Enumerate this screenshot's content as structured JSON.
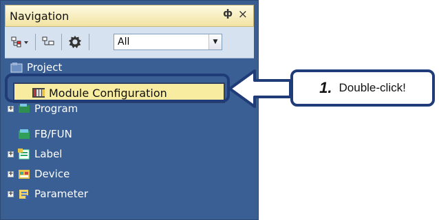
{
  "nav": {
    "title": "Navigation",
    "pin_glyph": "ф",
    "close_glyph": "×",
    "filter_value": "All",
    "tree": [
      {
        "label": "Project",
        "icon": "project-icon"
      },
      {
        "label": "Module Configuration",
        "icon": "module-configuration-icon",
        "selected": true
      },
      {
        "label": "Program",
        "icon": "program-icon",
        "expandable": true
      },
      {
        "label": "FB/FUN",
        "icon": "fb-fun-icon"
      },
      {
        "label": "Label",
        "icon": "label-icon",
        "expandable": true
      },
      {
        "label": "Device",
        "icon": "device-icon",
        "expandable": true
      },
      {
        "label": "Parameter",
        "icon": "parameter-icon",
        "expandable": true
      }
    ]
  },
  "callout": {
    "step": "1.",
    "text": "Double-click!"
  },
  "colors": {
    "window_bg": "#3b5e91",
    "highlight": "#f7ec9f",
    "frame": "#1f3b78"
  }
}
